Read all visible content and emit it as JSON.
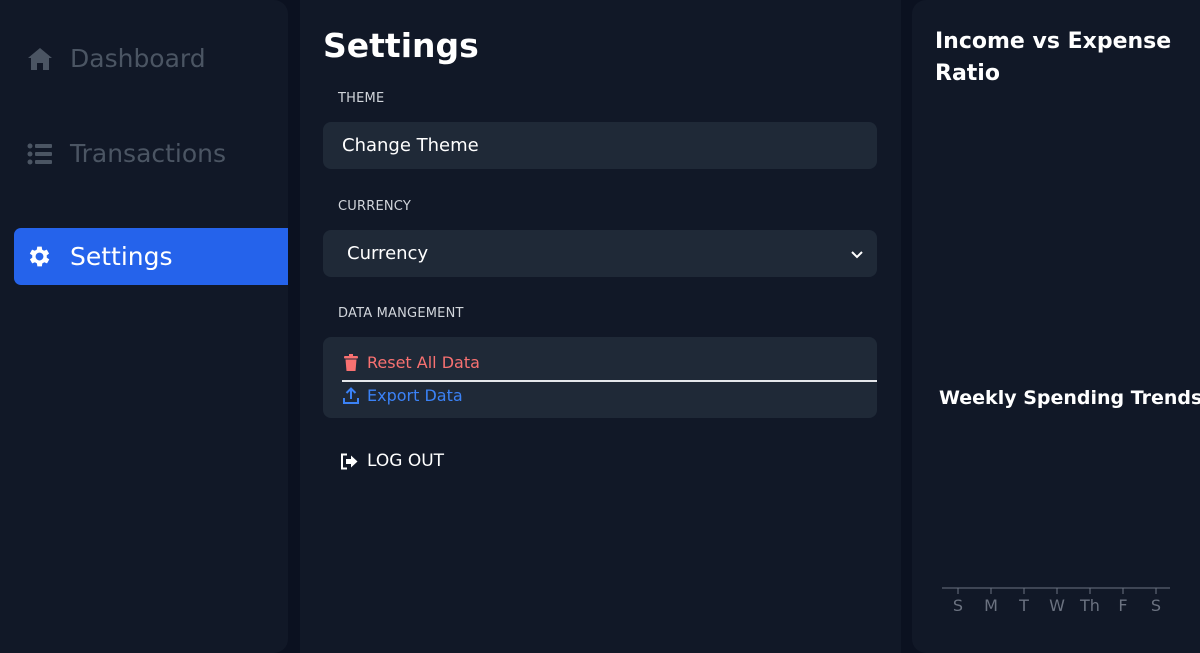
{
  "sidebar": {
    "items": [
      {
        "label": "Dashboard",
        "icon": "home-icon",
        "active": false
      },
      {
        "label": "Transactions",
        "icon": "list-icon",
        "active": false
      },
      {
        "label": "Settings",
        "icon": "gear-icon",
        "active": true
      }
    ]
  },
  "main": {
    "title": "Settings",
    "theme": {
      "label": "THEME",
      "button_label": "Change Theme"
    },
    "currency": {
      "label": "CURRENCY",
      "selected": "Currency"
    },
    "data_management": {
      "label": "DATA MANGEMENT",
      "reset_label": "Reset All Data",
      "export_label": "Export Data"
    },
    "logout_label": "LOG OUT"
  },
  "right_panel": {
    "income_expense_title": "Income vs Expense Ratio",
    "weekly_title": "Weekly Spending Trends"
  },
  "chart_data": {
    "type": "bar",
    "categories": [
      "S",
      "M",
      "T",
      "W",
      "Th",
      "F",
      "S"
    ],
    "series": []
  },
  "colors": {
    "accent": "#2563eb",
    "danger": "#f87171",
    "link": "#3b82f6",
    "panel": "#111827",
    "field": "#1f2937"
  }
}
